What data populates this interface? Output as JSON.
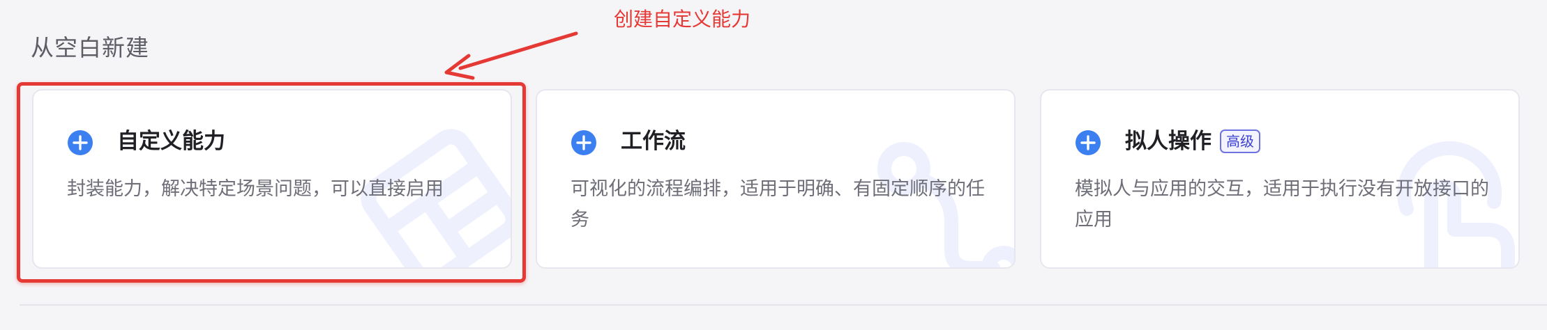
{
  "section": {
    "title": "从空白新建"
  },
  "annotation": {
    "label": "创建自定义能力",
    "color": "#e53935"
  },
  "cards": [
    {
      "title": "自定义能力",
      "description": "封装能力，解决特定场景问题，可以直接启用",
      "icon": "plus-circle-icon",
      "background_icon": "grid-module-icon",
      "highlighted": true
    },
    {
      "title": "工作流",
      "description": "可视化的流程编排，适用于明确、有固定顺序的任务",
      "icon": "plus-circle-icon",
      "background_icon": "workflow-path-icon"
    },
    {
      "title": "拟人操作",
      "badge": "高级",
      "description": "模拟人与应用的交互，适用于执行没有开放接口的应用",
      "icon": "plus-circle-icon",
      "background_icon": "touch-hand-icon"
    }
  ],
  "colors": {
    "accent_blue": "#3b7ff0",
    "badge": "#3a3fd0",
    "watermark": "#eef0fd"
  }
}
